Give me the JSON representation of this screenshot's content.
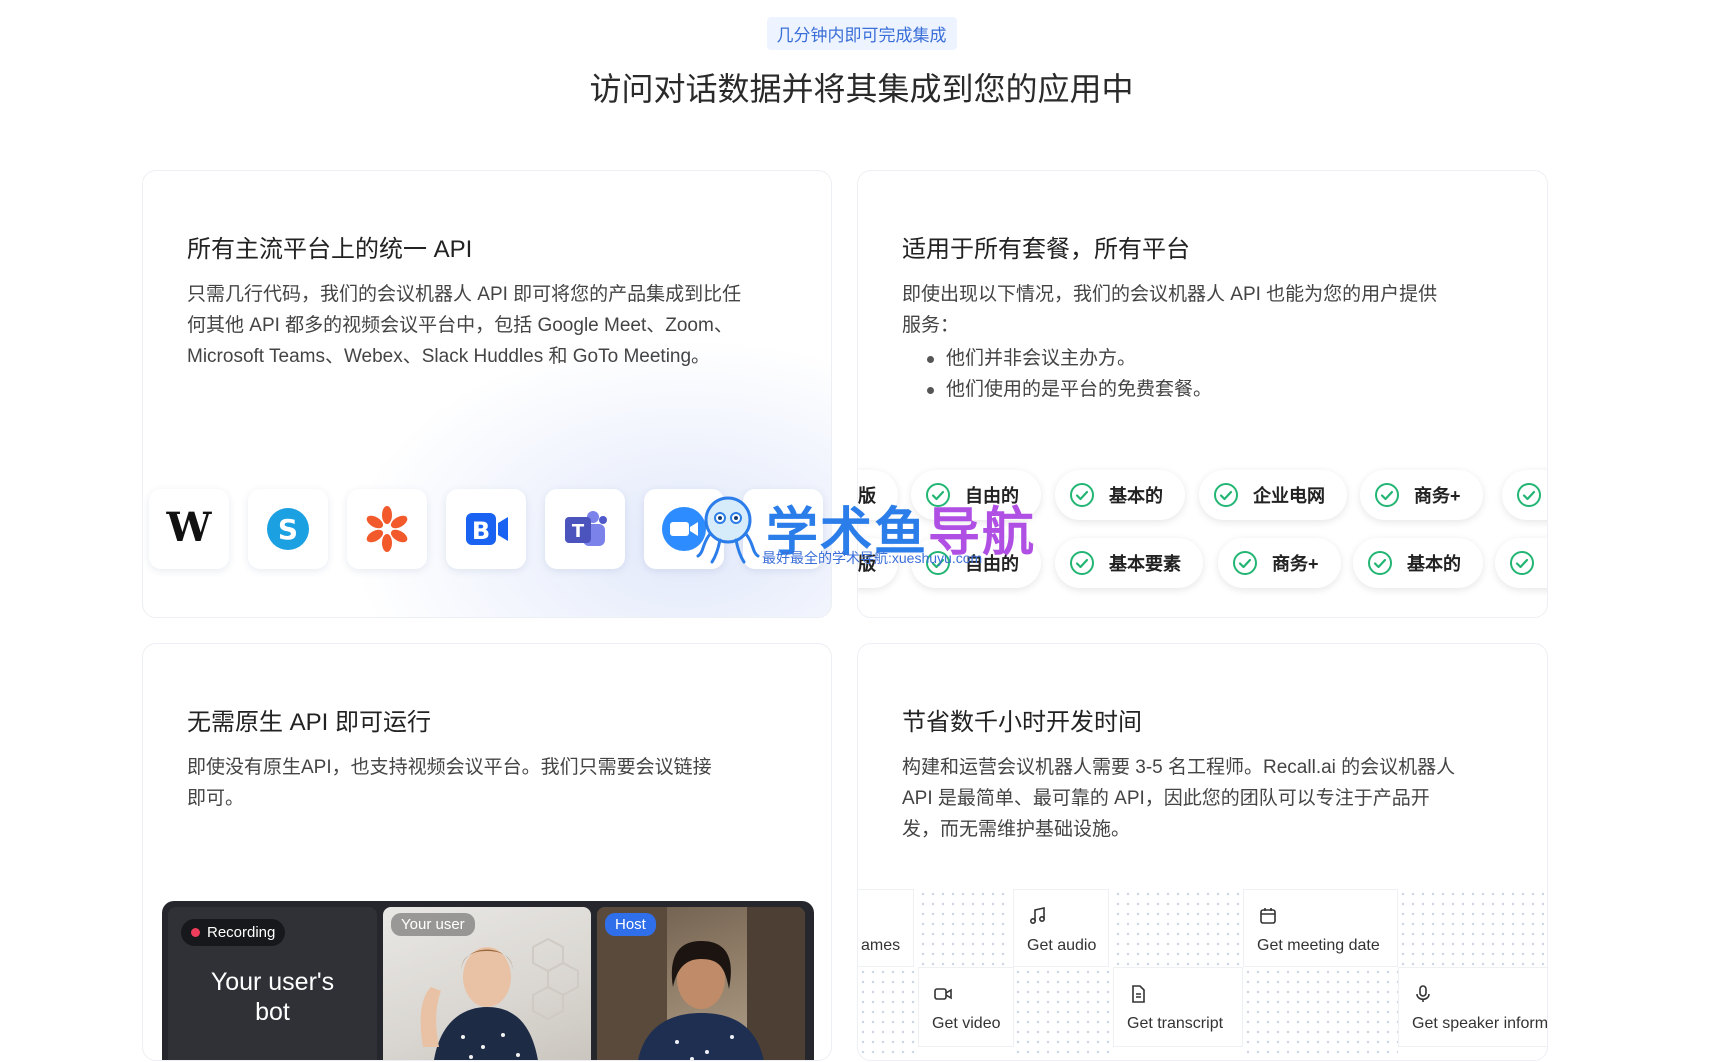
{
  "header": {
    "eyebrow": "几分钟内即可完成集成",
    "headline": "访问对话数据并将其集成到您的应用中"
  },
  "cards": {
    "api": {
      "title": "所有主流平台上的统一 API",
      "desc_lines": [
        "只需几行代码，我们的会议机器人 API 即可将您的产品集成到比任",
        "何其他 API 都多的视频会议平台中，包括 Google Meet、Zoom、",
        "Microsoft Teams、Webex、Slack Huddles 和 GoTo Meeting。"
      ],
      "logos": [
        "webex-w-icon",
        "skype-icon",
        "asterisk-app-icon",
        "blue-b-meeting-icon",
        "microsoft-teams-icon",
        "zoom-icon"
      ]
    },
    "plans": {
      "title": "适用于所有套餐，所有平台",
      "desc_lines": [
        "即使出现以下情况，我们的会议机器人 API 也能为您的用户提供",
        "服务："
      ],
      "bullets": [
        "他们并非会议主办方。",
        "他们使用的是平台的免费套餐。"
      ],
      "pills_row1": [
        "版",
        "自由的",
        "基本的",
        "企业电网",
        "商务+",
        ""
      ],
      "pills_row2": [
        "版",
        "自由的",
        "基本要素",
        "商务+",
        "基本的",
        ""
      ]
    },
    "native": {
      "title": "无需原生 API 即可运行",
      "desc_lines": [
        "即使没有原生API，也支持视频会议平台。我们只需要会议链接",
        "即可。"
      ],
      "meeting": {
        "recording": "Recording",
        "bot_label_1": "Your user's",
        "bot_label_2": "bot",
        "user_badge": "Your user",
        "host_badge": "Host"
      }
    },
    "time": {
      "title": "节省数千小时开发时间",
      "desc_lines": [
        "构建和运营会议机器人需要 3-5 名工程师。Recall.ai 的会议机器人",
        "API 是最简单、最可靠的 API，因此您的团队可以专注于产品开",
        "发，而无需维护基础设施。"
      ],
      "features": {
        "names": "ames",
        "audio": "Get audio",
        "meeting_date": "Get meeting date",
        "video": "Get video",
        "transcript": "Get transcript",
        "speaker": "Get speaker informa"
      }
    }
  },
  "watermark": {
    "title_a": "学术鱼",
    "title_b": "导航",
    "subtitle": "最好最全的学术导航:xueshuyu.com"
  },
  "colors": {
    "accent": "#3b6fd8",
    "check_green": "#22b573",
    "recording_red": "#ef3d5b",
    "host_blue": "#2f6fea"
  }
}
